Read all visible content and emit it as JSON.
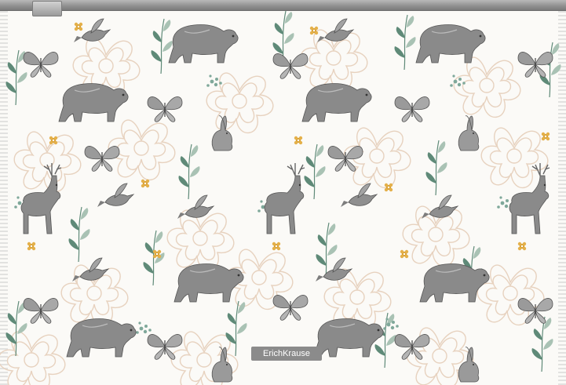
{
  "product": {
    "brand_label": "ErichKrause"
  },
  "colors": {
    "background": "#fbfaf7",
    "zipper": "#8f8f8f",
    "animal": "#7d7d7d",
    "leaf": "#5f8a78",
    "leaf_light": "#a9c2b4",
    "flower_outline": "#e7d2bf",
    "blossom": "#d8a033",
    "berry": "#7fa89a"
  },
  "pattern": {
    "motifs": [
      "bear-icon",
      "deer-icon",
      "rabbit-icon",
      "butterfly-icon",
      "bird-icon",
      "flower-icon",
      "leaf-icon",
      "berry-icon"
    ]
  }
}
